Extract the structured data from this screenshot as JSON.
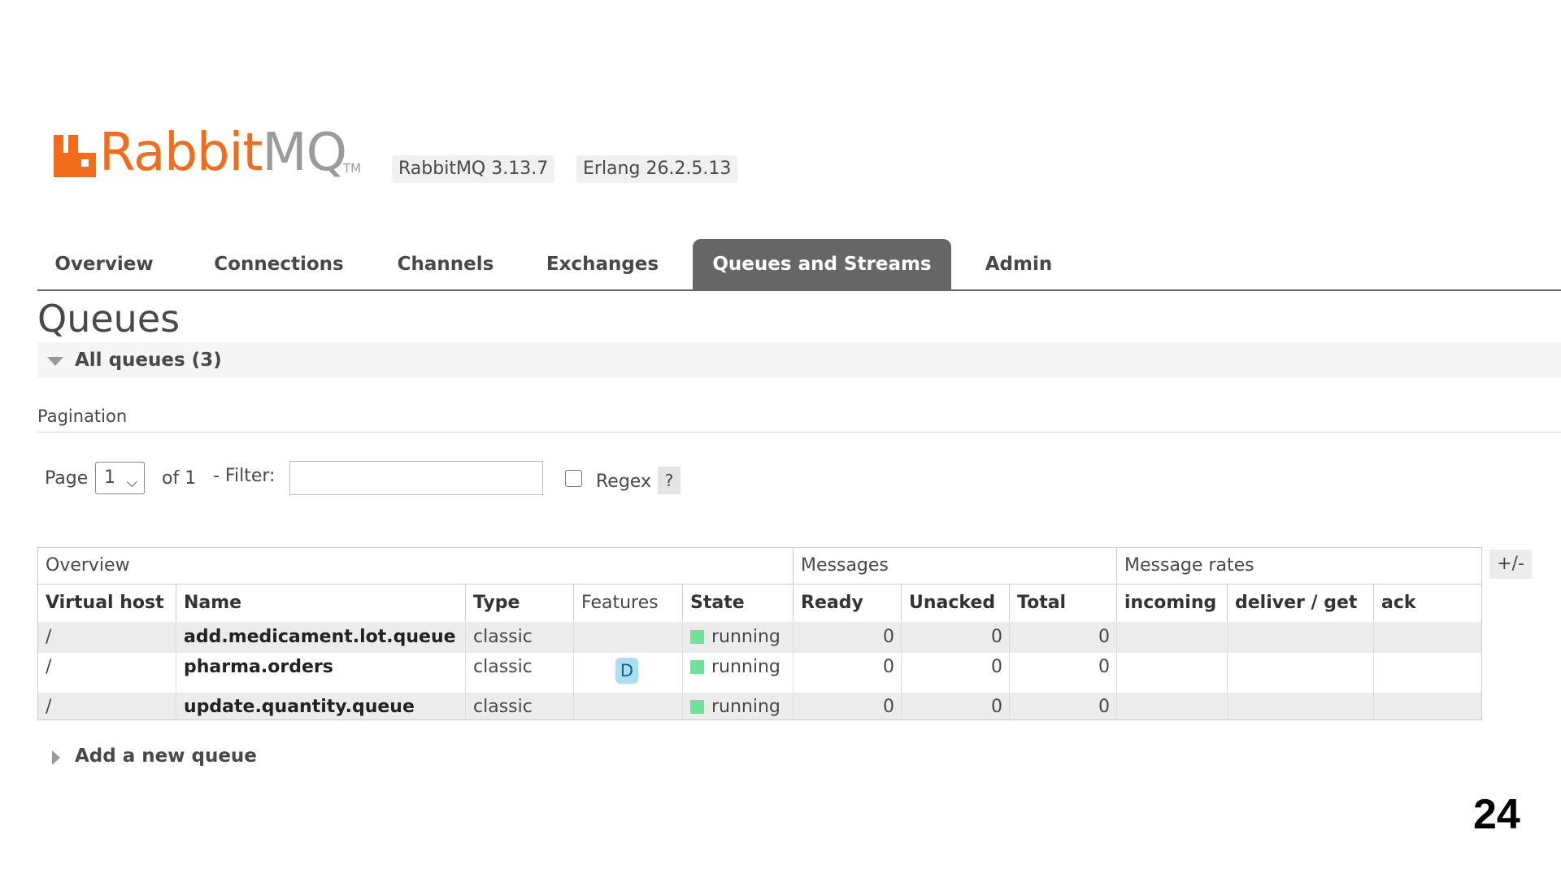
{
  "header": {
    "logo_text_primary": "Rabbit",
    "logo_text_secondary": "MQ",
    "logo_tm": "TM",
    "version_badge": "RabbitMQ 3.13.7",
    "erlang_badge": "Erlang 26.2.5.13",
    "brand_color": "#f26c1a"
  },
  "tabs": [
    {
      "label": "Overview",
      "active": false
    },
    {
      "label": "Connections",
      "active": false
    },
    {
      "label": "Channels",
      "active": false
    },
    {
      "label": "Exchanges",
      "active": false
    },
    {
      "label": "Queues and Streams",
      "active": true
    },
    {
      "label": "Admin",
      "active": false
    }
  ],
  "page_title": "Queues",
  "all_queues_label": "All queues (3)",
  "pagination": {
    "section_label": "Pagination",
    "page_label": "Page",
    "page_value": "1",
    "of_label": "of 1",
    "filter_label": "- Filter:",
    "filter_value": "",
    "regex_label": "Regex",
    "regex_checked": false,
    "help_label": "?"
  },
  "table": {
    "group_headers": [
      "Overview",
      "Messages",
      "Message rates"
    ],
    "columns": [
      "Virtual host",
      "Name",
      "Type",
      "Features",
      "State",
      "Ready",
      "Unacked",
      "Total",
      "incoming",
      "deliver / get",
      "ack"
    ],
    "rows": [
      {
        "vhost": "/",
        "name": "add.medicament.lot.queue",
        "type": "classic",
        "features": "",
        "state": "running",
        "ready": "0",
        "unacked": "0",
        "total": "0",
        "incoming": "",
        "deliver_get": "",
        "ack": ""
      },
      {
        "vhost": "/",
        "name": "pharma.orders",
        "type": "classic",
        "features": "D",
        "state": "running",
        "ready": "0",
        "unacked": "0",
        "total": "0",
        "incoming": "",
        "deliver_get": "",
        "ack": ""
      },
      {
        "vhost": "/",
        "name": "update.quantity.queue",
        "type": "classic",
        "features": "",
        "state": "running",
        "ready": "0",
        "unacked": "0",
        "total": "0",
        "incoming": "",
        "deliver_get": "",
        "ack": ""
      }
    ],
    "columns_toggle_label": "+/-",
    "state_color": "#6ee29a"
  },
  "add_queue_label": "Add a new queue",
  "slide_number": "24"
}
